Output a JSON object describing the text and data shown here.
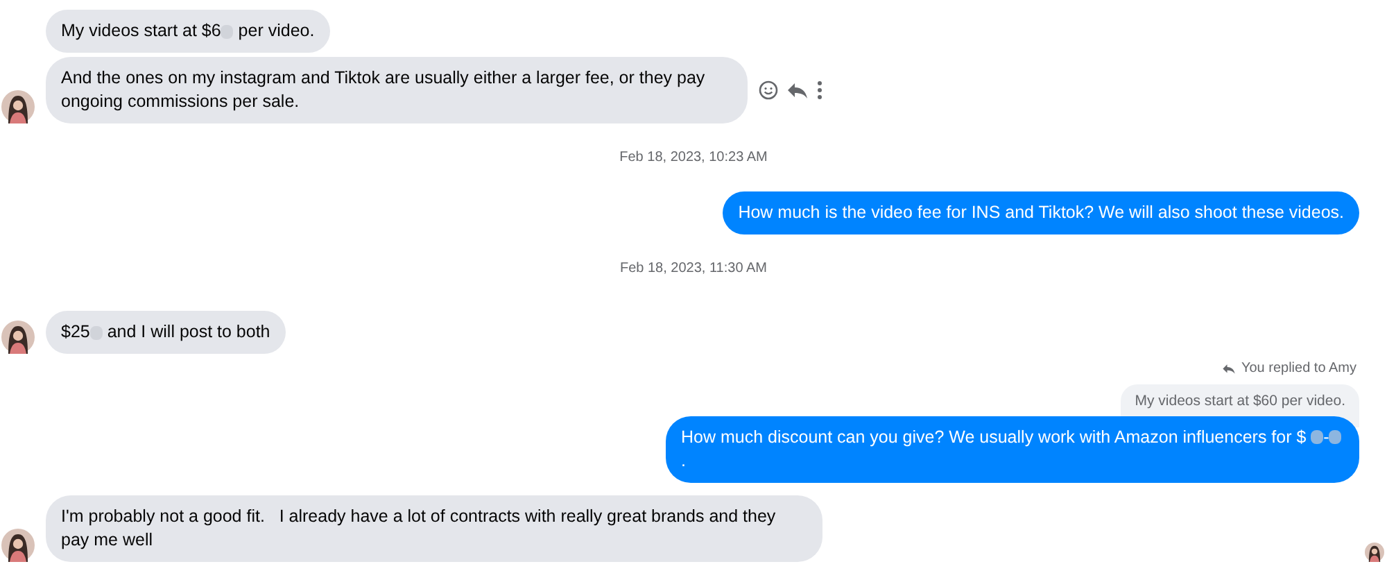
{
  "messages": [
    {
      "kind": "incoming",
      "avatar": false,
      "actions": false,
      "parts": [
        {
          "kind": "text",
          "text": "My videos start at $6"
        },
        {
          "kind": "blur"
        },
        {
          "kind": "text",
          "text": " per video."
        }
      ]
    },
    {
      "kind": "incoming",
      "avatar": true,
      "actions": true,
      "parts": [
        {
          "kind": "text",
          "text": "And the ones on my instagram and Tiktok are usually either a larger fee, or they pay ongoing commissions per sale."
        }
      ]
    },
    {
      "kind": "date",
      "text": "Feb 18, 2023, 10:23 AM"
    },
    {
      "kind": "outgoing",
      "parts": [
        {
          "kind": "text",
          "text": "How much is the video fee for INS and Tiktok? We will also shoot these videos."
        }
      ]
    },
    {
      "kind": "date",
      "text": "Feb 18, 2023, 11:30 AM"
    },
    {
      "kind": "incoming",
      "avatar": true,
      "actions": false,
      "parts": [
        {
          "kind": "text",
          "text": "$25"
        },
        {
          "kind": "blur"
        },
        {
          "kind": "text",
          "text": " and I will post to both"
        }
      ]
    },
    {
      "kind": "outgoing",
      "reply_label": "You replied to Amy",
      "quoted": "My videos start at $60 per video.",
      "parts": [
        {
          "kind": "text",
          "text": "How much discount can you give? We usually work with Amazon influencers for $ "
        },
        {
          "kind": "blur"
        },
        {
          "kind": "text",
          "text": "-"
        },
        {
          "kind": "blur"
        },
        {
          "kind": "text",
          "text": "."
        }
      ]
    },
    {
      "kind": "incoming",
      "avatar": true,
      "actions": false,
      "seen": true,
      "parts": [
        {
          "kind": "text",
          "text": "I'm probably not a good fit.   I already have a lot of contracts with really great brands and they pay me well"
        }
      ]
    }
  ]
}
